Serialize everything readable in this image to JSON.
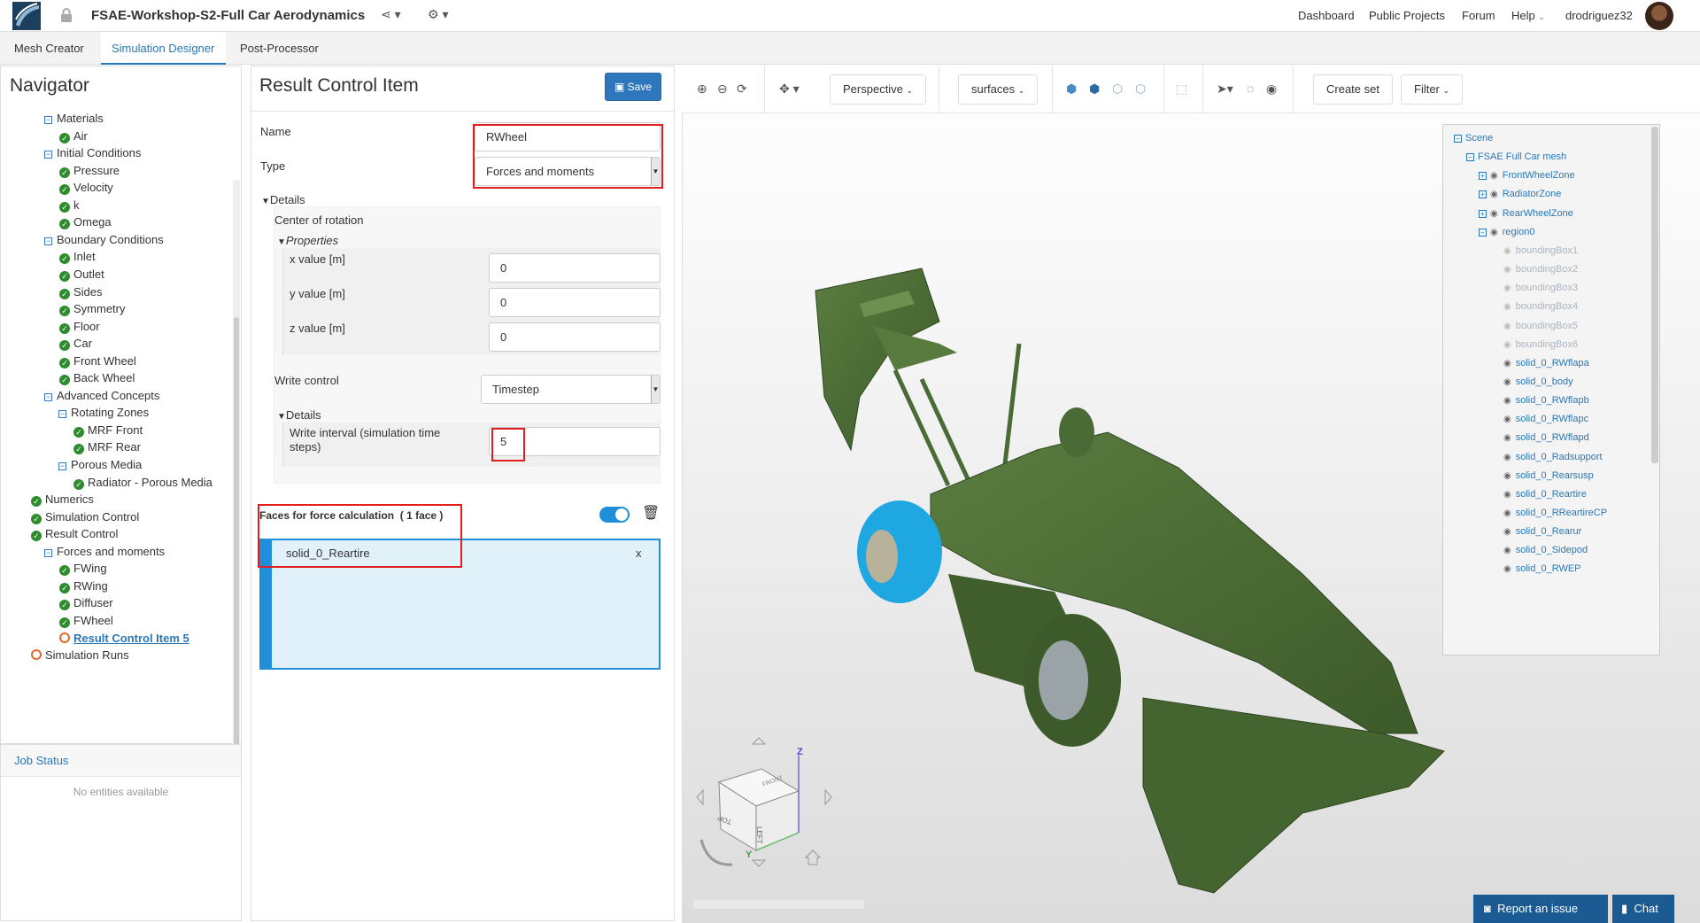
{
  "app": {
    "project_title": "FSAE-Workshop-S2-Full Car Aerodynamics",
    "nav_links": [
      "Dashboard",
      "Public Projects",
      "Forum",
      "Help",
      "drodriguez32"
    ],
    "icons": {
      "logo": "simscale-logo",
      "lock": "lock-icon",
      "share": "share-icon",
      "settings": "gear-icon",
      "avatar": "user-avatar"
    }
  },
  "tabs": [
    "Mesh Creator",
    "Simulation Designer",
    "Post-Processor"
  ],
  "active_tab": "Simulation Designer",
  "navigator": {
    "title": "Navigator",
    "items": [
      {
        "label": "Materials",
        "level": 2,
        "kind": "minus"
      },
      {
        "label": "Air",
        "level": 3,
        "kind": "check"
      },
      {
        "label": "Initial Conditions",
        "level": 2,
        "kind": "minus"
      },
      {
        "label": "Pressure",
        "level": 3,
        "kind": "check"
      },
      {
        "label": "Velocity",
        "level": 3,
        "kind": "check"
      },
      {
        "label": "k",
        "level": 3,
        "kind": "check"
      },
      {
        "label": "Omega",
        "level": 3,
        "kind": "check"
      },
      {
        "label": "Boundary Conditions",
        "level": 2,
        "kind": "minus"
      },
      {
        "label": "Inlet",
        "level": 3,
        "kind": "check"
      },
      {
        "label": "Outlet",
        "level": 3,
        "kind": "check"
      },
      {
        "label": "Sides",
        "level": 3,
        "kind": "check"
      },
      {
        "label": "Symmetry",
        "level": 3,
        "kind": "check"
      },
      {
        "label": "Floor",
        "level": 3,
        "kind": "check"
      },
      {
        "label": "Car",
        "level": 3,
        "kind": "check"
      },
      {
        "label": "Front Wheel",
        "level": 3,
        "kind": "check"
      },
      {
        "label": "Back Wheel",
        "level": 3,
        "kind": "check"
      },
      {
        "label": "Advanced Concepts",
        "level": 2,
        "kind": "minus"
      },
      {
        "label": "Rotating Zones",
        "level": 3,
        "kind": "minus"
      },
      {
        "label": "MRF Front",
        "level": 4,
        "kind": "check"
      },
      {
        "label": "MRF Rear",
        "level": 4,
        "kind": "check"
      },
      {
        "label": "Porous Media",
        "level": 3,
        "kind": "minus"
      },
      {
        "label": "Radiator - Porous Media",
        "level": 4,
        "kind": "check"
      },
      {
        "label": "Numerics",
        "level": 1,
        "kind": "check"
      },
      {
        "label": "Simulation Control",
        "level": 1,
        "kind": "check"
      },
      {
        "label": "Result Control",
        "level": 1,
        "kind": "check-minus"
      },
      {
        "label": "Forces and moments",
        "level": 2,
        "kind": "minus"
      },
      {
        "label": "FWing",
        "level": 3,
        "kind": "check"
      },
      {
        "label": "RWing",
        "level": 3,
        "kind": "check"
      },
      {
        "label": "Diffuser",
        "level": 3,
        "kind": "check"
      },
      {
        "label": "FWheel",
        "level": 3,
        "kind": "check"
      },
      {
        "label": "Result Control Item 5",
        "level": 3,
        "kind": "pending-link"
      },
      {
        "label": "Simulation Runs",
        "level": 1,
        "kind": "pending"
      }
    ]
  },
  "job_status": {
    "title": "Job Status",
    "empty_text": "No entities available"
  },
  "result_control": {
    "title": "Result Control Item",
    "save_label": "Save",
    "name_label": "Name",
    "name_value": "RWheel",
    "type_label": "Type",
    "type_value": "Forces and moments",
    "details_label": "Details",
    "center_label": "Center of rotation",
    "properties_label": "Properties",
    "x_label": "x value [m]",
    "x_value": "0",
    "y_label": "y value [m]",
    "y_value": "0",
    "z_label": "z value [m]",
    "z_value": "0",
    "write_control_label": "Write control",
    "write_control_value": "Timestep",
    "details2_label": "Details",
    "write_interval_label": "Write interval (simulation time steps)",
    "write_interval_value": "5",
    "faces_label": "Faces for force calculation",
    "faces_count": "( 1 face )",
    "faces": [
      {
        "name": "solid_0_Reartire",
        "remove": "x"
      }
    ],
    "toggle_on": true
  },
  "viewer": {
    "toolbar": {
      "camera_label": "Perspective",
      "render_label": "surfaces",
      "create_set_label": "Create set",
      "filter_label": "Filter"
    },
    "scene_tree": [
      {
        "label": "Scene",
        "indent": 0,
        "kind": "minus"
      },
      {
        "label": "FSAE Full Car mesh",
        "indent": 1,
        "kind": "minus"
      },
      {
        "label": "FrontWheelZone",
        "indent": 2,
        "kind": "plus-eye"
      },
      {
        "label": "RadiatorZone",
        "indent": 2,
        "kind": "plus-eye"
      },
      {
        "label": "RearWheelZone",
        "indent": 2,
        "kind": "plus-eye"
      },
      {
        "label": "region0",
        "indent": 2,
        "kind": "minus-eye"
      },
      {
        "label": "boundingBox1",
        "indent": 3,
        "kind": "dim"
      },
      {
        "label": "boundingBox2",
        "indent": 3,
        "kind": "dim"
      },
      {
        "label": "boundingBox3",
        "indent": 3,
        "kind": "dim"
      },
      {
        "label": "boundingBox4",
        "indent": 3,
        "kind": "dim"
      },
      {
        "label": "boundingBox5",
        "indent": 3,
        "kind": "dim"
      },
      {
        "label": "boundingBox6",
        "indent": 3,
        "kind": "dim"
      },
      {
        "label": "solid_0_RWflapa",
        "indent": 3,
        "kind": "eye"
      },
      {
        "label": "solid_0_body",
        "indent": 3,
        "kind": "eye"
      },
      {
        "label": "solid_0_RWflapb",
        "indent": 3,
        "kind": "eye"
      },
      {
        "label": "solid_0_RWflapc",
        "indent": 3,
        "kind": "eye"
      },
      {
        "label": "solid_0_RWflapd",
        "indent": 3,
        "kind": "eye"
      },
      {
        "label": "solid_0_Radsupport",
        "indent": 3,
        "kind": "eye"
      },
      {
        "label": "solid_0_Rearsusp",
        "indent": 3,
        "kind": "eye"
      },
      {
        "label": "solid_0_Reartire",
        "indent": 3,
        "kind": "eye"
      },
      {
        "label": "solid_0_RReartireCP",
        "indent": 3,
        "kind": "eye"
      },
      {
        "label": "solid_0_Rearur",
        "indent": 3,
        "kind": "eye"
      },
      {
        "label": "solid_0_Sidepod",
        "indent": 3,
        "kind": "eye"
      },
      {
        "label": "solid_0_RWEP",
        "indent": 3,
        "kind": "eye"
      }
    ],
    "cube_labels": {
      "top": "TOP",
      "left": "LEFT",
      "front": "FRONT",
      "z": "Z",
      "y": "Y"
    },
    "report_label": "Report an issue",
    "chat_label": "Chat",
    "model_color": "#4a6b35",
    "highlight_color": "#1ea7e0"
  }
}
